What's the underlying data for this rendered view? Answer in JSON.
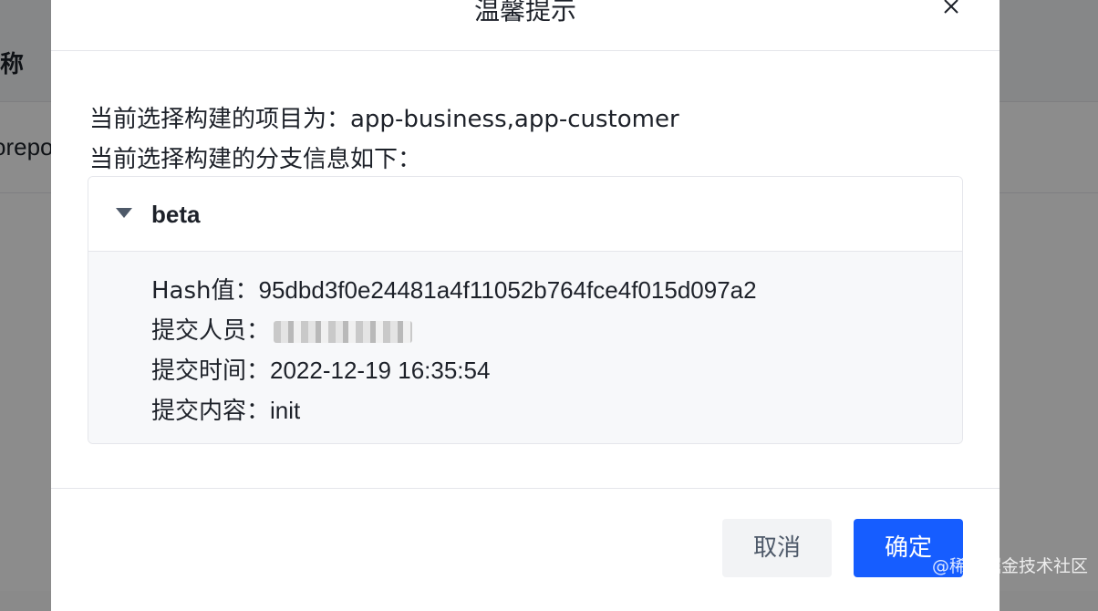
{
  "background": {
    "column_header": "称",
    "row_text": "orepo"
  },
  "modal": {
    "title": "温馨提示",
    "close_icon": "close-icon",
    "project_line": "当前选择构建的项目为：app-business,app-customer",
    "branch_line": "当前选择构建的分支信息如下：",
    "collapse": {
      "title": "beta",
      "expanded": true,
      "hash_label": "Hash值：",
      "hash_value": "95dbd3f0e24481a4f11052b764fce4f015d097a2",
      "committer_label": "提交人员：",
      "time_label": "提交时间：",
      "time_value": "2022-12-19 16:35:54",
      "content_label": "提交内容：",
      "content_value": "init"
    },
    "footer": {
      "cancel_label": "取消",
      "ok_label": "确定"
    }
  },
  "watermark": "@稀土掘金技术社区",
  "colors": {
    "primary": "#165dff",
    "overlay": "rgba(0,0,0,0.45)",
    "panel_bg": "#f7f8fa"
  }
}
